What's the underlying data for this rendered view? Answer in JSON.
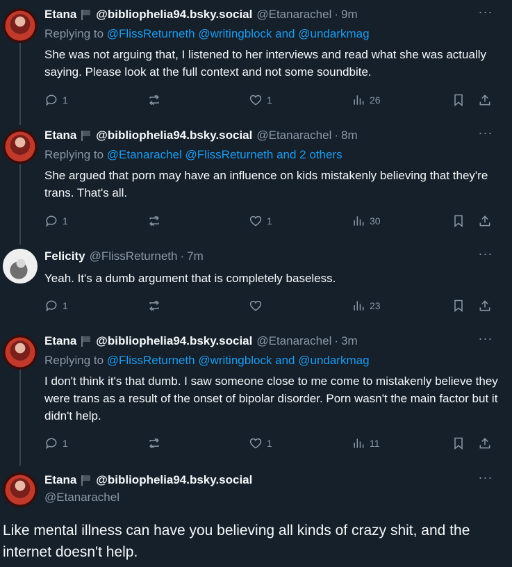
{
  "tweets": [
    {
      "name": "Etana",
      "bsky": "@bibliophelia94.bsky.social",
      "handle": "@Etanarachel",
      "time": "9m",
      "replying_prefix": "Replying to ",
      "replying_links": "@FlissReturneth @writingblock and @undarkmag",
      "body": "She was not arguing that, I listened to her interviews and read what she was actually saying. Please look at the full context and not some soundbite.",
      "replies": "1",
      "likes": "1",
      "views": "26"
    },
    {
      "name": "Etana",
      "bsky": "@bibliophelia94.bsky.social",
      "handle": "@Etanarachel",
      "time": "8m",
      "replying_prefix": "Replying to ",
      "replying_links": "@Etanarachel @FlissReturneth and 2 others",
      "body": "She argued that porn may have an influence on kids mistakenly believing that they're trans. That's all.",
      "replies": "1",
      "likes": "1",
      "views": "30"
    },
    {
      "name": "Felicity",
      "handle": "@FlissReturneth",
      "time": "7m",
      "body": "Yeah. It's a dumb argument that is completely baseless.",
      "replies": "1",
      "likes": "",
      "views": "23"
    },
    {
      "name": "Etana",
      "bsky": "@bibliophelia94.bsky.social",
      "handle": "@Etanarachel",
      "time": "3m",
      "replying_prefix": "Replying to ",
      "replying_links": "@FlissReturneth @writingblock and @undarkmag",
      "body": "I don't think it's that dumb. I saw someone close to me come to mistakenly believe they were trans as a result of the onset of bipolar disorder. Porn wasn't the main factor but it didn't help.",
      "replies": "1",
      "likes": "1",
      "views": "11"
    }
  ],
  "main_tweet": {
    "name": "Etana",
    "bsky": "@bibliophelia94.bsky.social",
    "handle": "@Etanarachel",
    "body": "Like mental illness can have you believing all kinds of crazy shit, and the internet doesn't help."
  },
  "separator": "·",
  "more_label": "···",
  "icons": [
    "reply-icon",
    "retweet-icon",
    "like-icon",
    "views-icon",
    "bookmark-icon",
    "share-icon",
    "flag-icon",
    "more-icon"
  ]
}
